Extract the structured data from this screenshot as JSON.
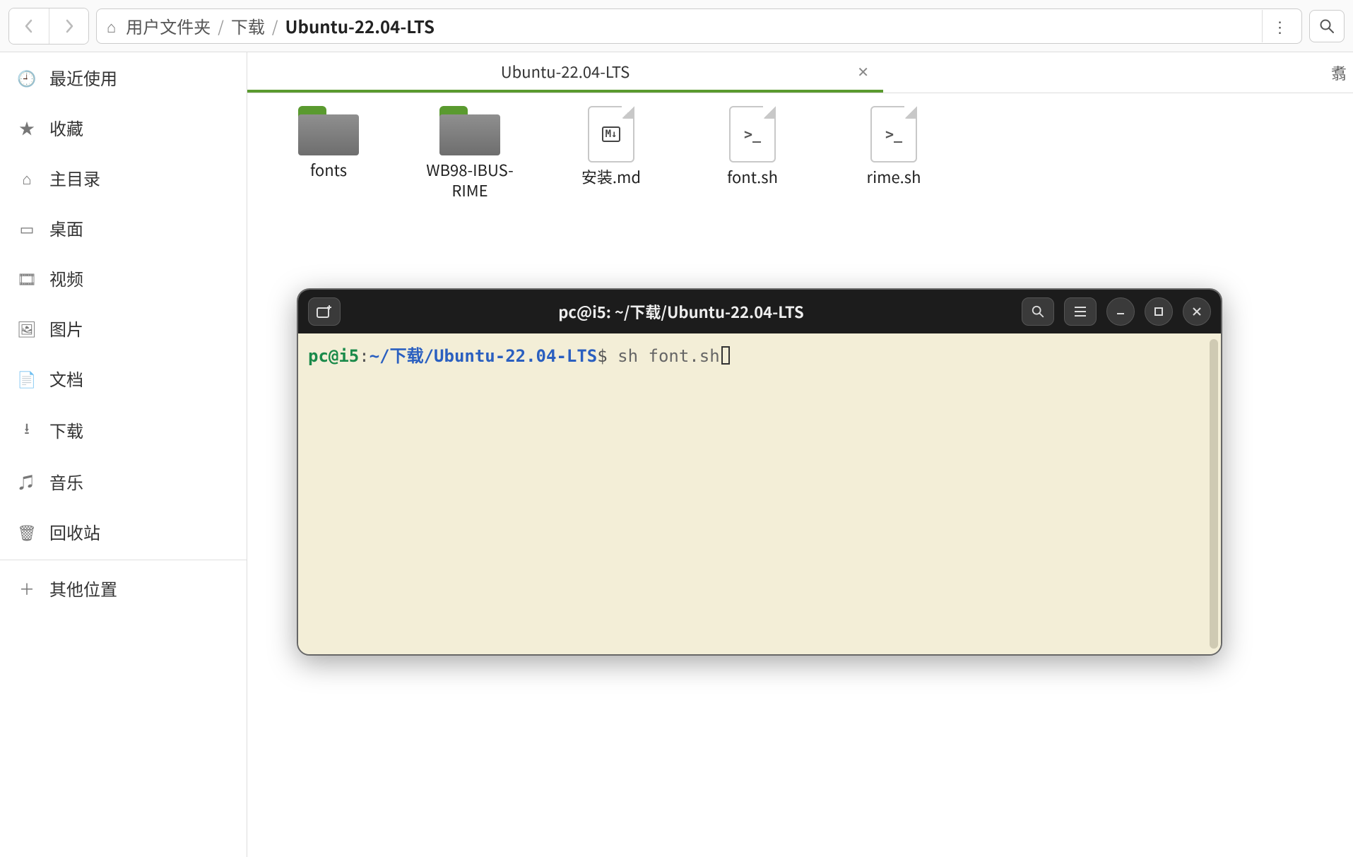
{
  "toolbar": {
    "breadcrumb": {
      "segment1": "用户文件夹",
      "segment2": "下载",
      "segment3": "Ubuntu-22.04-LTS"
    }
  },
  "sidebar": {
    "items": [
      {
        "label": "最近使用",
        "icon": "🕘"
      },
      {
        "label": "收藏",
        "icon": "★"
      },
      {
        "label": "主目录",
        "icon": "⌂"
      },
      {
        "label": "桌面",
        "icon": "▭"
      },
      {
        "label": "视频",
        "icon": "🎞"
      },
      {
        "label": "图片",
        "icon": "🖼"
      },
      {
        "label": "文档",
        "icon": "📄"
      },
      {
        "label": "下载",
        "icon": "⭳"
      },
      {
        "label": "音乐",
        "icon": "♫"
      },
      {
        "label": "回收站",
        "icon": "🗑"
      }
    ],
    "other_label": "其他位置",
    "other_icon": "＋"
  },
  "tab": {
    "label": "Ubuntu-22.04-LTS",
    "overflow_char": "翥"
  },
  "files": [
    {
      "name": "fonts",
      "type": "folder"
    },
    {
      "name": "WB98-IBUS-RIME",
      "type": "folder"
    },
    {
      "name": "安装.md",
      "type": "md"
    },
    {
      "name": "font.sh",
      "type": "sh"
    },
    {
      "name": "rime.sh",
      "type": "sh"
    }
  ],
  "terminal": {
    "title": "pc@i5: ~/下载/Ubuntu-22.04-LTS",
    "prompt_user": "pc@i5",
    "prompt_sep": ":",
    "prompt_path": "~/下载/Ubuntu-22.04-LTS",
    "prompt_sym": "$",
    "command": "sh font.sh"
  },
  "icons": {
    "md_badge": "M↓",
    "sh_badge": ">_"
  }
}
